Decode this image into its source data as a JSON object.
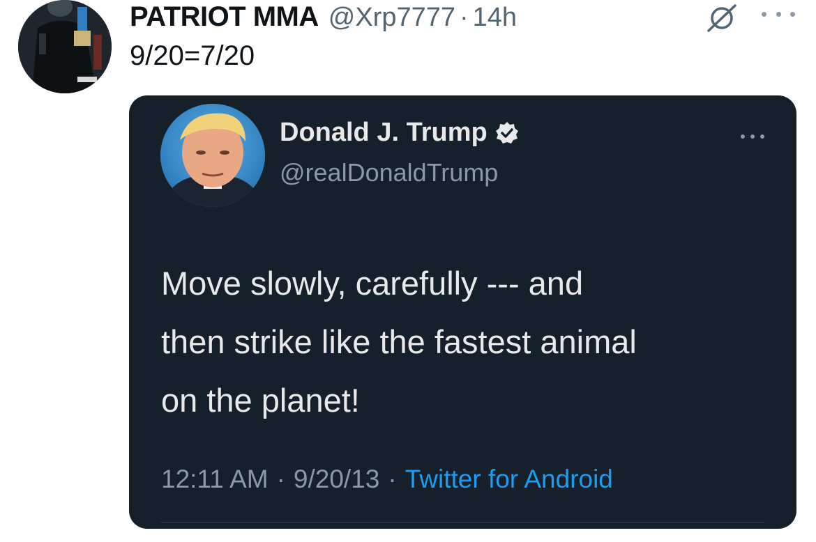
{
  "post": {
    "author": {
      "display_name": "PATRIOT MMA",
      "handle": "@Xrp7777",
      "avatar_icon": "user-avatar-icon"
    },
    "separator": "·",
    "time_ago": "14h",
    "text": "9/20=7/20",
    "actions": {
      "grok_icon": "grok-icon",
      "more_icon": "more-options-icon"
    }
  },
  "embedded_tweet": {
    "author": {
      "display_name": "Donald J. Trump",
      "handle": "@realDonaldTrump",
      "verified_icon": "verified-badge-icon",
      "avatar_icon": "user-avatar-icon"
    },
    "body_lines": [
      "Move slowly, carefully --- and",
      "then strike like the fastest animal",
      "on the planet!"
    ],
    "time": "12:11 AM",
    "separator": "·",
    "date": "9/20/13",
    "source": "Twitter for Android",
    "colors": {
      "background": "#15202b",
      "text": "#e7e9ea",
      "secondary": "#8b98a5",
      "link": "#1d9bf0"
    }
  },
  "colors": {
    "primary_text": "#0f1419",
    "secondary_text": "#536471",
    "page_background": "#ffffff"
  }
}
